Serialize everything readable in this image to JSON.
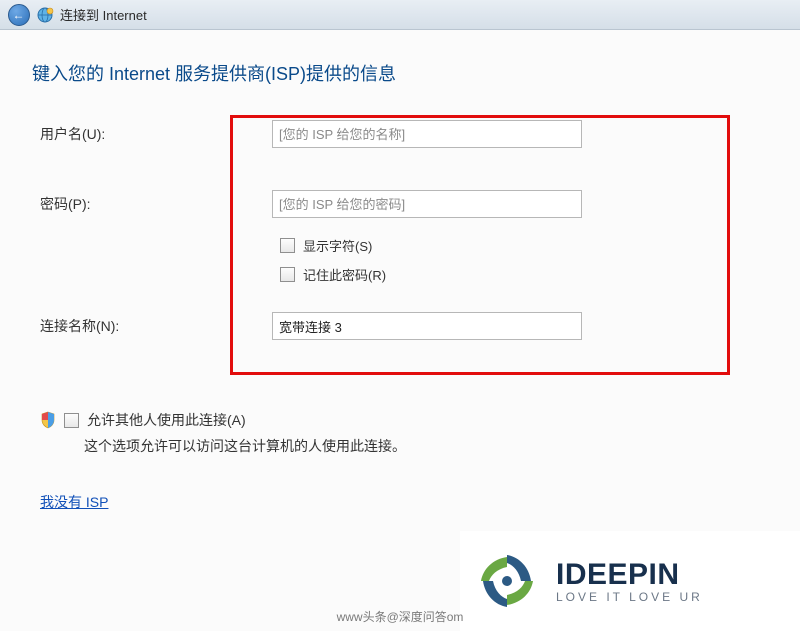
{
  "titlebar": {
    "title": "连接到 Internet"
  },
  "heading": "键入您的 Internet 服务提供商(ISP)提供的信息",
  "form": {
    "username": {
      "label": "用户名(U):",
      "placeholder": "[您的 ISP 给您的名称]",
      "value": ""
    },
    "password": {
      "label": "密码(P):",
      "placeholder": "[您的 ISP 给您的密码]",
      "value": ""
    },
    "show_chars": {
      "label": "显示字符(S)",
      "checked": false
    },
    "remember": {
      "label": "记住此密码(R)",
      "checked": false
    },
    "conn_name": {
      "label": "连接名称(N):",
      "value": "宽带连接 3"
    }
  },
  "allow": {
    "label": "允许其他人使用此连接(A)",
    "desc": "这个选项允许可以访问这台计算机的人使用此连接。",
    "checked": false
  },
  "link": "我没有 ISP",
  "brand": {
    "name": "IDEEPIN",
    "sub": "LOVE IT  LOVE UR"
  },
  "watermark": "www头条@深度问答om"
}
